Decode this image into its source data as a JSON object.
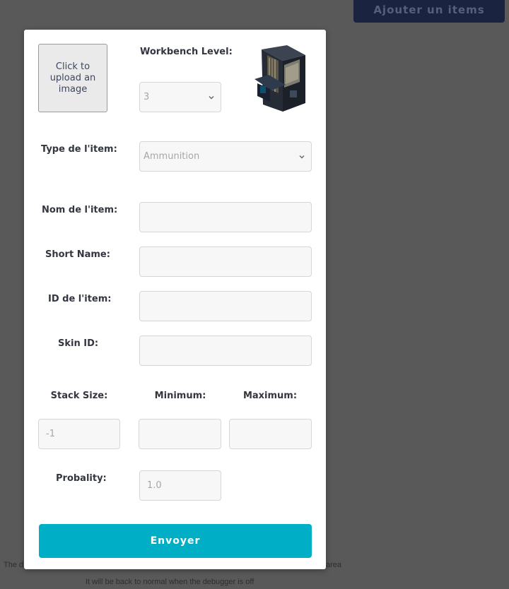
{
  "background": {
    "action_button_label": "Ajouter un items",
    "debug_line1_start": "The d",
    "debug_line1_end": "area",
    "debug_line2": "It will be back to normal when the debugger is off"
  },
  "form": {
    "upload_label": "Click to upload an image",
    "workbench_label": "Workbench Level:",
    "workbench_value": "3",
    "type_label": "Type de l'item:",
    "type_value": "Ammunition",
    "name_label": "Nom de l'item:",
    "name_value": "",
    "shortname_label": "Short Name:",
    "shortname_value": "",
    "id_label": "ID de l'item:",
    "id_value": "",
    "skin_label": "Skin ID:",
    "skin_value": "",
    "stack_label": "Stack Size:",
    "stack_value": "-1",
    "min_label": "Minimum:",
    "min_value": "",
    "max_label": "Maximum:",
    "max_value": "",
    "prob_label": "Probality:",
    "prob_value": "1.0",
    "submit_label": "Envoyer"
  },
  "colors": {
    "overlay": "#595959",
    "accent": "#00aec5",
    "dark_button": "#1a2340"
  }
}
